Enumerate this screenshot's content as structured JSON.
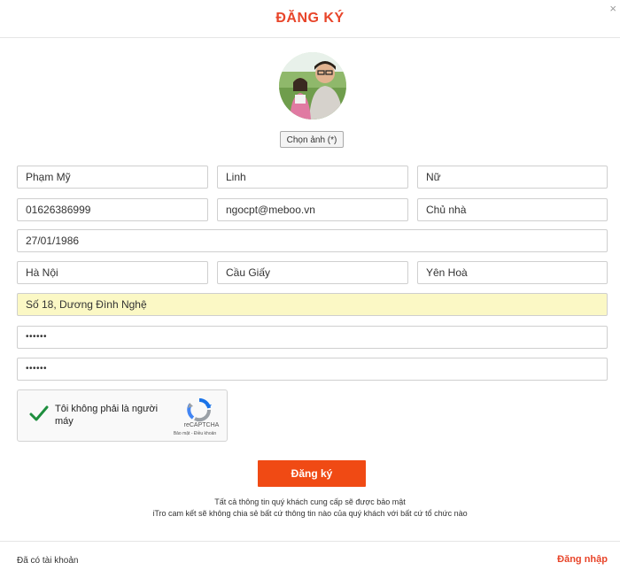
{
  "modal": {
    "title": "ĐĂNG KÝ",
    "close_icon": "close-icon",
    "close_glyph": "×"
  },
  "avatar": {
    "choose_button_label": "Chọn ảnh (*)"
  },
  "form": {
    "last_name": "Phạm Mỹ",
    "first_name": "Linh",
    "gender": "Nữ",
    "phone": "01626386999",
    "email": "ngocpt@meboo.vn",
    "role": "Chủ nhà",
    "birthday": "27/01/1986",
    "city": "Hà Nội",
    "district": "Cầu Giấy",
    "ward": "Yên Hoà",
    "address": "Số 18, Dương Đình Nghệ",
    "password": "••••••",
    "password_confirm": "••••••"
  },
  "captcha": {
    "label": "Tôi không phải là người máy",
    "brand": "reCAPTCHA",
    "links": "Bảo mật - Điều khoản",
    "checked": true
  },
  "submit_label": "Đăng ký",
  "notice": {
    "line1": "Tất cả thông tin quý khách cung cấp sẽ được bảo mật",
    "line2": "iTro cam kết sẽ không chia sẻ bất cứ thông tin nào của quý khách với bất cứ tổ chức nào"
  },
  "footer": {
    "has_account": "Đã có tài khoản",
    "login_link": "Đăng nhập"
  },
  "colors": {
    "accent": "#e8452a",
    "button": "#f04a14",
    "highlight_field": "#fbf8c5",
    "check": "#1e8e3e"
  }
}
